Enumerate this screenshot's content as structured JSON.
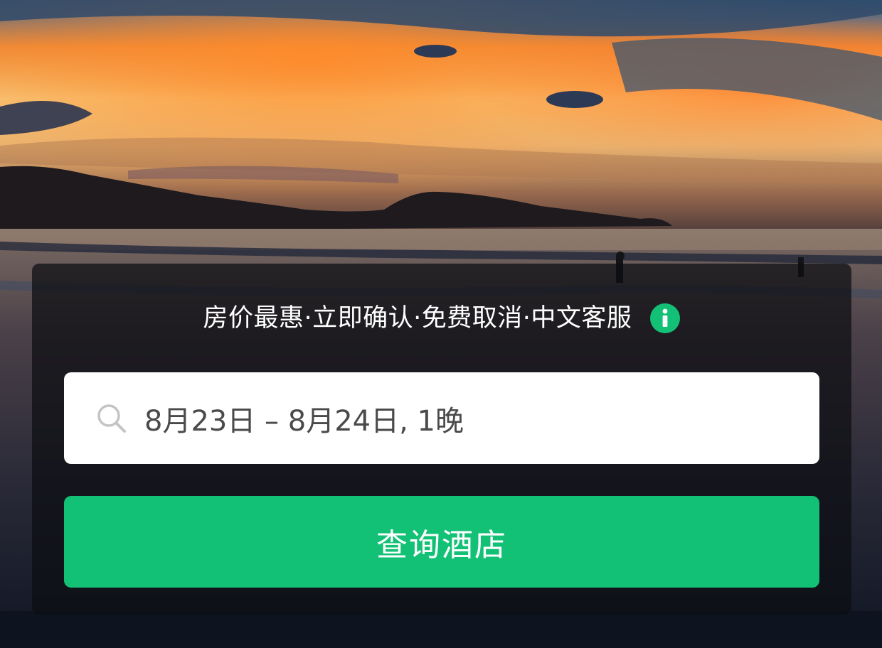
{
  "hero": {
    "image": "sunset-beach-photo"
  },
  "promo": {
    "text": "房价最惠·立即确认·免费取消·中文客服",
    "info_icon": "info-icon"
  },
  "date_field": {
    "icon": "search-icon",
    "value": "8月23日 – 8月24日, 1晚"
  },
  "search_button": {
    "label": "查询酒店"
  },
  "colors": {
    "accent": "#13c176",
    "panel": "#0c0e12",
    "field_text": "#4a4a4a"
  }
}
